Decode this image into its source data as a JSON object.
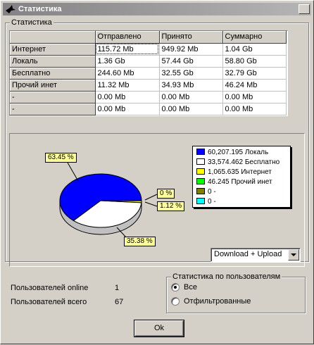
{
  "window": {
    "title": "Статистика"
  },
  "table_group": {
    "label": "Статистика"
  },
  "table": {
    "columns": [
      "Отправлено",
      "Принято",
      "Суммарно"
    ],
    "rows": [
      {
        "name": "Интернет",
        "sent": "115.72 Mb",
        "received": "949.92 Mb",
        "total": "1.04 Gb"
      },
      {
        "name": "Локаль",
        "sent": "1.36 Gb",
        "received": "57.44 Gb",
        "total": "58.80 Gb"
      },
      {
        "name": "Бесплатно",
        "sent": "244.60 Mb",
        "received": "32.55 Gb",
        "total": "32.79 Gb"
      },
      {
        "name": "Прочий инет",
        "sent": "11.32 Mb",
        "received": "34.93 Mb",
        "total": "46.24 Mb"
      },
      {
        "name": "-",
        "sent": "0.00 Mb",
        "received": "0.00 Mb",
        "total": "0.00 Mb"
      },
      {
        "name": "-",
        "sent": "0.00 Mb",
        "received": "0.00 Mb",
        "total": "0.00 Mb"
      }
    ]
  },
  "chart_data": {
    "type": "pie",
    "slices": [
      {
        "label": "Локаль",
        "value": 60207.195,
        "value_text": "60,207.195",
        "percent": 63.45,
        "percent_text": "63.45 %",
        "color": "#0000ff"
      },
      {
        "label": "Бесплатно",
        "value": 33574.462,
        "value_text": "33,574.462",
        "percent": 35.38,
        "percent_text": "35.38 %",
        "color": "#ffffff"
      },
      {
        "label": "Интернет",
        "value": 1065.635,
        "value_text": "1,065.635",
        "percent": 1.12,
        "percent_text": "1.12 %",
        "color": "#ffff00"
      },
      {
        "label": "Прочий инет",
        "value": 46.245,
        "value_text": "46.245",
        "percent": 0,
        "percent_text": "0 %",
        "color": "#00ff00"
      },
      {
        "label": "-",
        "value": 0,
        "value_text": "0",
        "color": "#808000"
      },
      {
        "label": "-",
        "value": 0,
        "value_text": "0",
        "color": "#00ffff"
      }
    ]
  },
  "chart_mode": {
    "selected": "Download + Upload"
  },
  "users": {
    "online_label": "Пользователей online",
    "online_value": "1",
    "total_label": "Пользователей всего",
    "total_value": "67"
  },
  "user_stats_group": {
    "label": "Статистика по пользователям",
    "option_all": "Все",
    "option_filtered": "Отфильтрованные",
    "selected": "all"
  },
  "buttons": {
    "ok": "Ok"
  }
}
